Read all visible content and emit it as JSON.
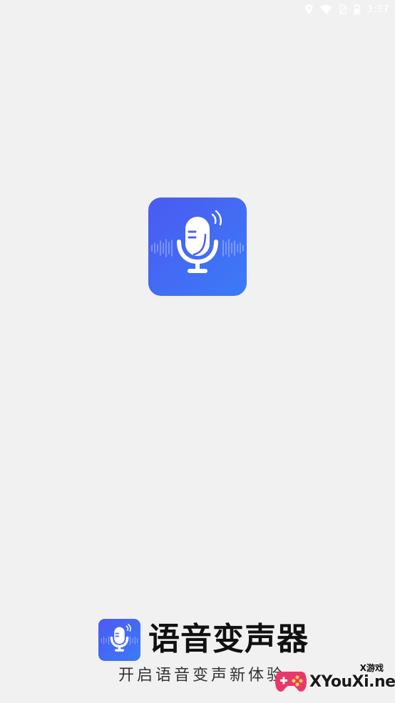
{
  "status_bar": {
    "time": "3:37",
    "icons": [
      "location-icon",
      "wifi-icon",
      "no-sim-icon",
      "battery-icon"
    ]
  },
  "splash": {
    "icon": "microphone-icon",
    "accent_color": "#4a66f4"
  },
  "brand": {
    "logo_icon": "microphone-icon",
    "title": "语音变声器",
    "slogan": "开启语音变声新体验"
  },
  "watermark": {
    "small_text": "X游戏",
    "text": "XYouXi.net",
    "icon": "gamepad-icon"
  }
}
